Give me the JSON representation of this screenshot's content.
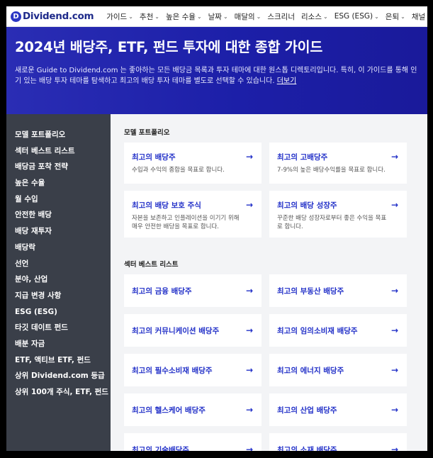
{
  "nav": {
    "logo_letter": "D",
    "logo_text": "Dividend.com",
    "items": [
      {
        "label": "가이드"
      },
      {
        "label": "추천"
      },
      {
        "label": "높은 수율"
      },
      {
        "label": "날짜"
      },
      {
        "label": "매달의"
      },
      {
        "label": "스크리너"
      },
      {
        "label": "리소스"
      },
      {
        "label": "ESG (ESG)"
      },
      {
        "label": "은퇴"
      },
      {
        "label": "채널"
      }
    ]
  },
  "hero": {
    "title": "2024년 배당주, ETF, 펀드 투자에 대한 종합 가이드",
    "description": "새로운 Guide to Dividend.com 는 좋아하는 모든 배당금 목록과 투자 테마에 대한 원스톱 디렉토리입니다. 특히, 이 가이드를 통해 인기 있는 배당 투자 테마를 탐색하고 최고의 배당 투자 테마를 별도로 선택할 수 있습니다.",
    "more_link": "더보기"
  },
  "sidebar": {
    "items": [
      {
        "label": "모델 포트폴리오"
      },
      {
        "label": "섹터 베스트 리스트"
      },
      {
        "label": "배당금 포착 전략"
      },
      {
        "label": "높은 수율"
      },
      {
        "label": "월 수입"
      },
      {
        "label": "안전한 배당"
      },
      {
        "label": "배당 재투자"
      },
      {
        "label": "배당락"
      },
      {
        "label": "선언"
      },
      {
        "label": "분야, 산업"
      },
      {
        "label": "지급 변경 사항"
      },
      {
        "label": "ESG (ESG)"
      },
      {
        "label": "타깃 데이트 펀드"
      },
      {
        "label": "배분 자금"
      },
      {
        "label": "ETF, 액티브 ETF, 펀드"
      },
      {
        "label": "상위 Dividend.com 등급"
      },
      {
        "label": "상위 100개 주식, ETF, 펀드"
      }
    ]
  },
  "sections": {
    "model": {
      "title": "모델 포트폴리오",
      "cards": [
        {
          "title": "최고의 배당주",
          "desc": "수입과 수익의 종합을 목표로 합니다."
        },
        {
          "title": "최고의 고배당주",
          "desc": "7-9%의 높은 배당수익률을 목표로 합니다."
        },
        {
          "title": "최고의 배당 보호 주식",
          "desc": "자본을 보존하고 인플레이션을 이기기 위해 매우 안전한 배당을 목표로 합니다."
        },
        {
          "title": "최고의 배당 성장주",
          "desc": "꾸준한 배당 성장자로부터 좋은 수익을 목표로 합니다."
        }
      ]
    },
    "sector": {
      "title": "섹터 베스트 리스트",
      "cards": [
        {
          "title": "최고의 금융 배당주"
        },
        {
          "title": "최고의 부동산 배당주"
        },
        {
          "title": "최고의 커뮤니케이션 배당주"
        },
        {
          "title": "최고의 임의소비재 배당주"
        },
        {
          "title": "최고의 필수소비재 배당주"
        },
        {
          "title": "최고의 에너지 배당주"
        },
        {
          "title": "최고의 헬스케어 배당주"
        },
        {
          "title": "최고의 산업 배당주"
        },
        {
          "title": "최고의 기술배당주"
        },
        {
          "title": "최고의 소재 배당주"
        }
      ]
    }
  },
  "icons": {
    "arrow": "→",
    "chevron": "⌄"
  },
  "colors": {
    "brand": "#2b37c4",
    "hero_bg": "#1c1fa8",
    "sidebar_bg": "#3a3f49",
    "link": "#2230c8"
  }
}
